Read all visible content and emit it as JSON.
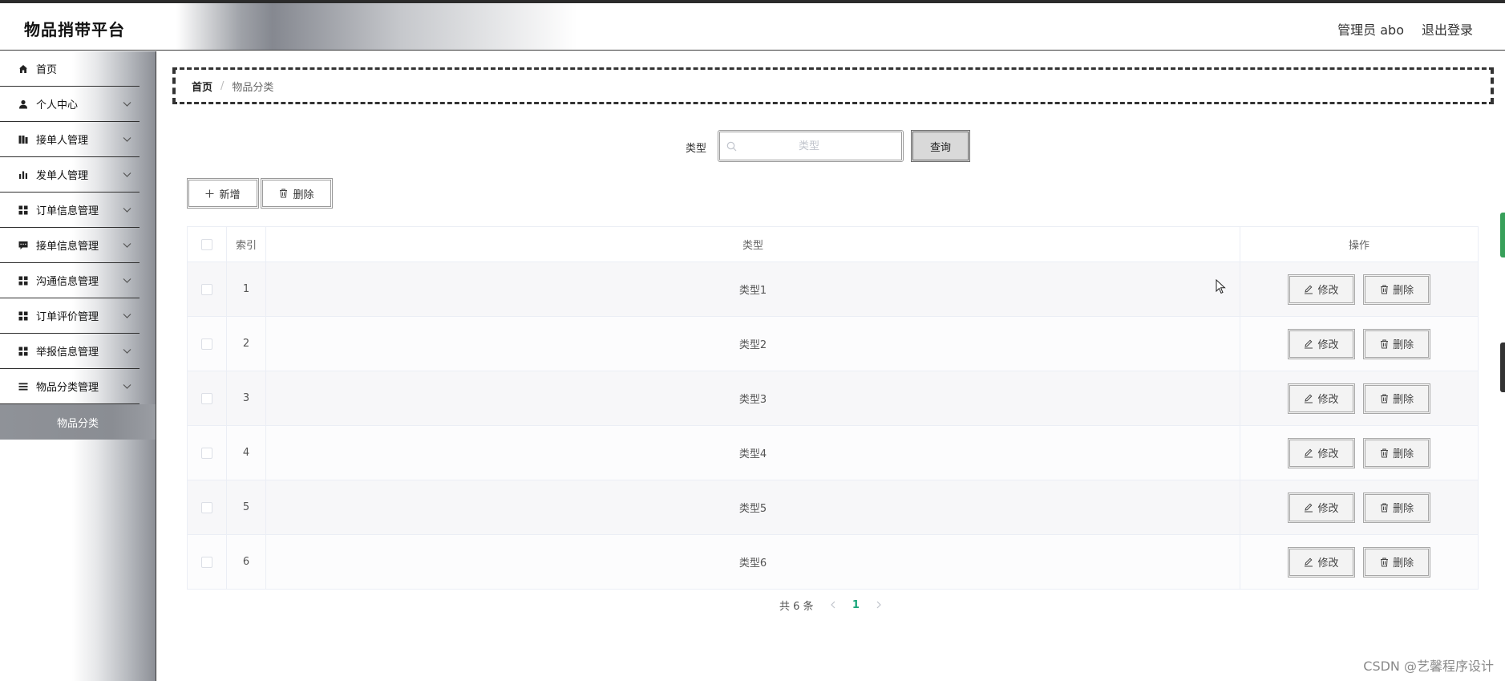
{
  "header": {
    "brand": "物品捎带平台",
    "user": "管理员 abo",
    "logout": "退出登录"
  },
  "sidebar": {
    "items": [
      {
        "label": "首页",
        "icon": "home-icon"
      },
      {
        "label": "个人中心",
        "icon": "user-icon"
      },
      {
        "label": "接单人管理",
        "icon": "chart-book-icon"
      },
      {
        "label": "发单人管理",
        "icon": "bar-chart-icon"
      },
      {
        "label": "订单信息管理",
        "icon": "grid-icon"
      },
      {
        "label": "接单信息管理",
        "icon": "message-icon"
      },
      {
        "label": "沟通信息管理",
        "icon": "grid-icon"
      },
      {
        "label": "订单评价管理",
        "icon": "grid-icon"
      },
      {
        "label": "举报信息管理",
        "icon": "grid-icon"
      },
      {
        "label": "物品分类管理",
        "icon": "list-icon"
      }
    ],
    "active_sub": "物品分类"
  },
  "breadcrumb": {
    "home": "首页",
    "separator": "/",
    "current": "物品分类"
  },
  "search": {
    "label": "类型",
    "placeholder": "类型",
    "value": "",
    "button": "查询"
  },
  "actions": {
    "add": "新增",
    "delete": "删除"
  },
  "table": {
    "headers": {
      "index": "索引",
      "type": "类型",
      "ops": "操作"
    },
    "edit_label": "修改",
    "delete_label": "删除",
    "rows": [
      {
        "index": "1",
        "type": "类型1"
      },
      {
        "index": "2",
        "type": "类型2"
      },
      {
        "index": "3",
        "type": "类型3"
      },
      {
        "index": "4",
        "type": "类型4"
      },
      {
        "index": "5",
        "type": "类型5"
      },
      {
        "index": "6",
        "type": "类型6"
      }
    ]
  },
  "pagination": {
    "total": "共 6 条",
    "current_page": "1"
  },
  "watermark": "CSDN @艺馨程序设计",
  "colors": {
    "accent": "#18a57a",
    "header_border": "#3a3a3a",
    "submenu_bg": "#8f9298"
  }
}
